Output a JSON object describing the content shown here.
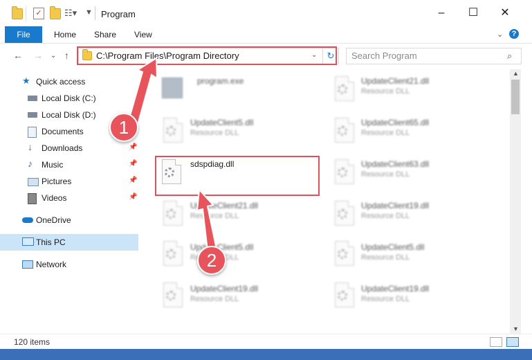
{
  "window": {
    "title": "Program"
  },
  "ribbon": {
    "tabs": [
      "File",
      "Home",
      "Share",
      "View"
    ]
  },
  "address": {
    "path": "C:\\Program Files\\Program Directory"
  },
  "search": {
    "placeholder": "Search Program"
  },
  "sidebar": {
    "items": [
      {
        "label": "Quick access",
        "icon": "star-icon"
      },
      {
        "label": "Local Disk (C:)",
        "icon": "drive-icon"
      },
      {
        "label": "Local Disk (D:)",
        "icon": "drive-icon"
      },
      {
        "label": "Documents",
        "icon": "documents-icon"
      },
      {
        "label": "Downloads",
        "icon": "download-arrow-icon"
      },
      {
        "label": "Music",
        "icon": "music-note-icon"
      },
      {
        "label": "Pictures",
        "icon": "picture-icon"
      },
      {
        "label": "Videos",
        "icon": "film-icon"
      },
      {
        "label": "OneDrive",
        "icon": "cloud-icon"
      },
      {
        "label": "This PC",
        "icon": "monitor-icon"
      },
      {
        "label": "Network",
        "icon": "network-icon"
      }
    ]
  },
  "files": {
    "left": [
      {
        "name": "program.exe",
        "type": ""
      },
      {
        "name": "UpdateClient5.dll",
        "type": "Resource DLL"
      },
      {
        "name": "sdspdiag.dll",
        "type": ""
      },
      {
        "name": "UpdateClient21.dll",
        "type": "Resource DLL"
      },
      {
        "name": "UpdateClient5.dll",
        "type": "Resource DLL"
      },
      {
        "name": "UpdateClient19.dll",
        "type": "Resource DLL"
      }
    ],
    "right": [
      {
        "name": "UpdateClient21.dll",
        "type": "Resource DLL"
      },
      {
        "name": "UpdateClient65.dll",
        "type": "Resource DLL"
      },
      {
        "name": "UpdateClient63.dll",
        "type": "Resource DLL"
      },
      {
        "name": "UpdateClient19.dll",
        "type": "Resource DLL"
      },
      {
        "name": "UpdateClient5.dll",
        "type": "Resource DLL"
      },
      {
        "name": "UpdateClient19.dll",
        "type": "Resource DLL"
      }
    ]
  },
  "callouts": {
    "one": "1",
    "two": "2"
  },
  "status": {
    "item_count": "120 items"
  },
  "colors": {
    "accent": "#1979ca",
    "highlight": "#e0505a"
  }
}
